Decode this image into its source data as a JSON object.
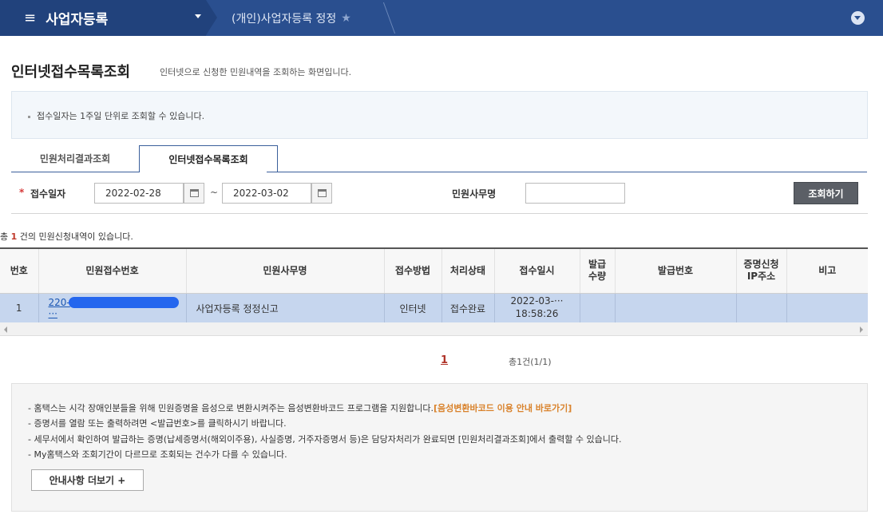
{
  "header": {
    "menu_icon": "≡",
    "menu_title": "사업자등록",
    "breadcrumb": "(개인)사업자등록 정정",
    "star_icon": "★"
  },
  "page": {
    "title": "인터넷접수목록조회",
    "subtitle": "인터넷으로 신청한 민원내역을 조회하는 화면입니다."
  },
  "notice": "접수일자는 1주일 단위로 조회할 수 있습니다.",
  "tabs": [
    {
      "label": "민원처리결과조회",
      "active": false
    },
    {
      "label": "인터넷접수목록조회",
      "active": true
    }
  ],
  "search": {
    "required_mark": "*",
    "date_label": "접수일자",
    "date_from": "2022-02-28",
    "date_to": "2022-03-02",
    "tilde": "~",
    "name_label": "민원사무명",
    "name_value": "",
    "search_button": "조회하기"
  },
  "summary": {
    "prefix": "총 ",
    "count": "1",
    "suffix": " 건의 민원신청내역이 있습니다."
  },
  "table": {
    "headers": [
      "번호",
      "민원접수번호",
      "민원사무명",
      "접수방법",
      "처리상태",
      "접수일시",
      "발급\n수량",
      "발급번호",
      "증명신청\nIP주소",
      "비고"
    ],
    "rows": [
      {
        "no": "1",
        "receipt_prefix": "220-",
        "receipt_suffix": "···",
        "service": "사업자등록 정정신고",
        "method": "인터넷",
        "status": "접수완료",
        "date": "2022-03-···",
        "time": "18:58:26",
        "qty": "",
        "issue_no": "",
        "ip": "",
        "note": ""
      }
    ]
  },
  "pagination": {
    "current": "1",
    "info": "총1건(1/1)"
  },
  "info": {
    "line1": "- 홈택스는 시각 장애인분들을 위해 민원증명을 음성으로 변환시켜주는 음성변환바코드 프로그램을 지원합니다.",
    "line1_link": "[음성변환바코드 이용 안내 바로가기]",
    "line2": "- 증명서를 열람 또는 출력하려면 <발급번호>를 클릭하시기 바랍니다.",
    "line3": "- 세무서에서 확인하여 발급하는 증명(납세증명서(해외이주용), 사실증명, 거주자증명서 등)은 담당자처리가 완료되면 [민원처리결과조회]에서 출력할 수 있습니다.",
    "line4": "- My홈택스와 조회기간이 다르므로 조회되는 건수가 다를 수 있습니다.",
    "more_button": "안내사항 더보기 +"
  },
  "colors": {
    "header_bg": "#2a4f8f",
    "selected_row": "#c6d6ee",
    "accent_red": "#b0342a",
    "link_orange": "#d9822b"
  }
}
